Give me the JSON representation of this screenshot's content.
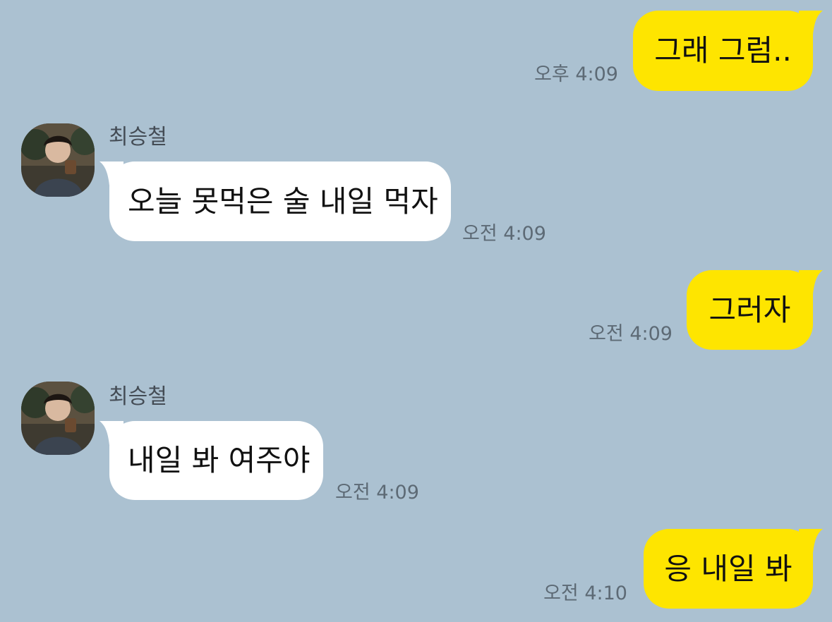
{
  "messages": [
    {
      "direction": "out",
      "text": "그래 그럼..",
      "time": "오후 4:09"
    },
    {
      "direction": "in",
      "sender": "최승철",
      "text": "오늘 못먹은 술 내일 먹자",
      "time": "오전 4:09",
      "avatar": "profile-photo-avatar"
    },
    {
      "direction": "out",
      "text": "그러자",
      "time": "오전 4:09"
    },
    {
      "direction": "in",
      "sender": "최승철",
      "text": "내일 봐 여주야",
      "time": "오전 4:09",
      "avatar": "profile-photo-avatar"
    },
    {
      "direction": "out",
      "text": "응 내일 봐",
      "time": "오전 4:10"
    }
  ],
  "colors": {
    "background": "#abc1d1",
    "outgoing_bubble": "#fee500",
    "incoming_bubble": "#ffffff",
    "time_text": "#5d6a75"
  }
}
